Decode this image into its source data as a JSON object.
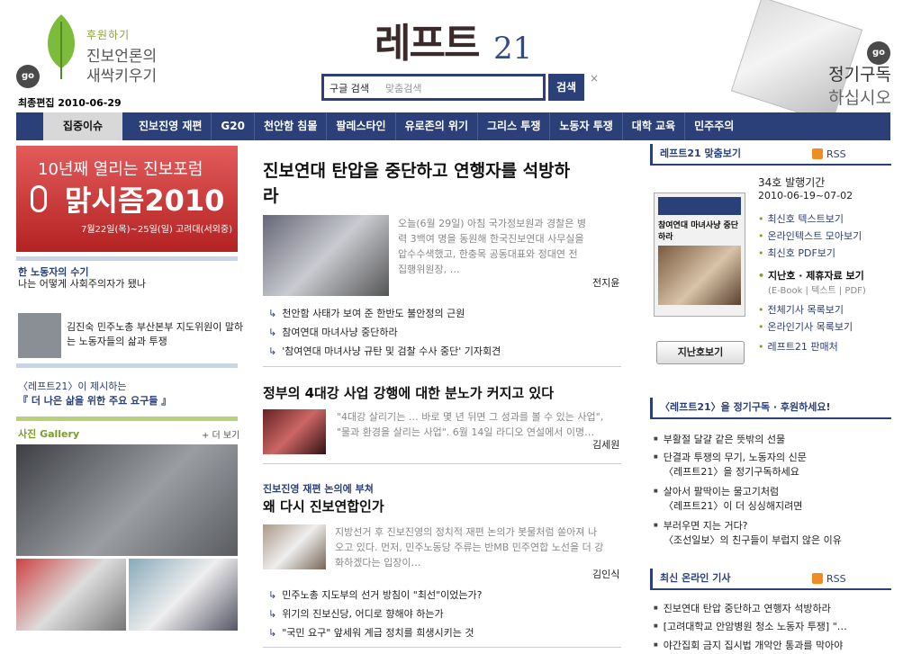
{
  "header": {
    "support_small": "후원하기",
    "support_big1": "진보언론의",
    "support_big2": "새싹키우기",
    "go": "go",
    "last_edit": "최종편집 2010-06-29",
    "logo": "레프트",
    "logo_num": "21",
    "search_select": "구글 검색",
    "search_placeholder": "맞춤검색",
    "search_button": "검색",
    "close": "×",
    "subscribe1": "정기구독",
    "subscribe2": "하십시오"
  },
  "nav": {
    "first": "집중이슈",
    "items": [
      "진보진영 재편",
      "G20",
      "천안함 침몰",
      "팔레스타인",
      "유로존의 위기",
      "그리스 투쟁",
      "노동자 투쟁",
      "대학 교육",
      "민주주의"
    ]
  },
  "left": {
    "banner": {
      "t1": "10년째 열리는 진보포럼",
      "t2": "맑시즘2010",
      "t3": "7월22일(목)~25일(일) 고려대(서외중)"
    },
    "story1": {
      "title": "한 노동자의 수기",
      "text": "나는 어떻게 사회주의자가 됐나"
    },
    "story2": {
      "text1": "김진숙 민주노총 부산본부 지도위원이 말하",
      "text2": "는 노동자들의 삶과 투쟁"
    },
    "story3": {
      "title": "〈레프트21〉이 제시하는",
      "text": "『 더 나은 삶을 위한 주요 요구들 』"
    },
    "gallery": {
      "title": "사진 Gallery",
      "more": "+ 더 보기"
    }
  },
  "main": {
    "a1": {
      "headline1": "진보연대 탄압을 중단하고 연행자를 석방하",
      "headline2": "라",
      "body": [
        "오늘(6월 29일) 아침 국가정보원과 경찰은 병",
        "력 3백여 명을 동원해 한국진보연대 사무실을",
        "압수수색했고, 한충목 공동대표와 정대연 전",
        "집행위원장, …"
      ],
      "author": "전지윤",
      "subs": [
        "천안함 사태가 보여 준 한반도 불안정의 근원",
        "참여연대 마녀사냥 중단하라",
        "'참여연대 마녀사냥 규탄 및 검찰 수사 중단' 기자회견"
      ]
    },
    "a2": {
      "headline": "정부의 4대강 사업 강행에 대한 분노가 커지고 있다",
      "body": [
        "\"4대강 살리기는 … 바로 몇 년 뒤면 그 성과를 볼 수 있는 사업\",",
        "\"물과 환경을 살리는 사업\". 6월 14일 라디오 연설에서 이명…"
      ],
      "author": "김세원"
    },
    "a3": {
      "kicker": "진보진영 재편 논의에 부쳐",
      "headline": "왜 다시 진보연합인가",
      "body": [
        "지방선거 후 진보진영의 정치적 재편 논의가 봇물처럼 쏟아져 나",
        "오고 있다. 먼저, 민주노동당 주류는 반MB 민주연합 노선을 더 강",
        "화하겠다는 입장이…"
      ],
      "author": "김인식",
      "subs": [
        "민주노총 지도부의 선거 방침이 \"최선\"이었는가?",
        "위기의 진보신당, 어디로 향해야 하는가",
        "\"국민 요구\" 앞세워 계급 정치를 희생시키는 것"
      ]
    }
  },
  "right": {
    "box1": {
      "title": "레프트21 맞춤보기",
      "rss": "RSS",
      "issue": "34호 발행기간",
      "period": "2010-06-19~07-02",
      "links": [
        "최신호 텍스트보기",
        "온라인텍스트 모아보기",
        "최신호 PDF보기"
      ],
      "archive_title": "지난호 · 제휴자료 보기",
      "archive_sub": "(E-Book | 텍스트 | PDF)",
      "links2": [
        "전체기사 목록보기",
        "온라인기사 목록보기",
        "레프트21 판매처"
      ],
      "prev_button": "지난호보기",
      "cover_text": "참여연대 마녀사냥 중단하라"
    },
    "box2": {
      "title": "〈레프트21〉을 정기구독 · 후원하세요!",
      "items": [
        [
          "부활절 달걀 같은 뜻밖의 선물"
        ],
        [
          "단결과 투쟁의 무기, 노동자의 신문",
          "〈레프트21〉을 정기구독하세요"
        ],
        [
          "살아서 팔딱이는 물고기처럼",
          "〈레프트21〉이 더 싱싱해지려면"
        ],
        [
          "부러우면 지는 거다?",
          "〈조선일보〉의 친구들이 부럽지 않은 이유"
        ]
      ]
    },
    "box3": {
      "title": "최신 온라인 기사",
      "rss": "RSS",
      "items": [
        "진보연대 탄압 중단하고 연행자 석방하라",
        "[고려대학교 안암병원 청소 노동자 투쟁] \"…",
        "야간집회 금지 집시법 개악안 통과를 막아야"
      ]
    }
  }
}
